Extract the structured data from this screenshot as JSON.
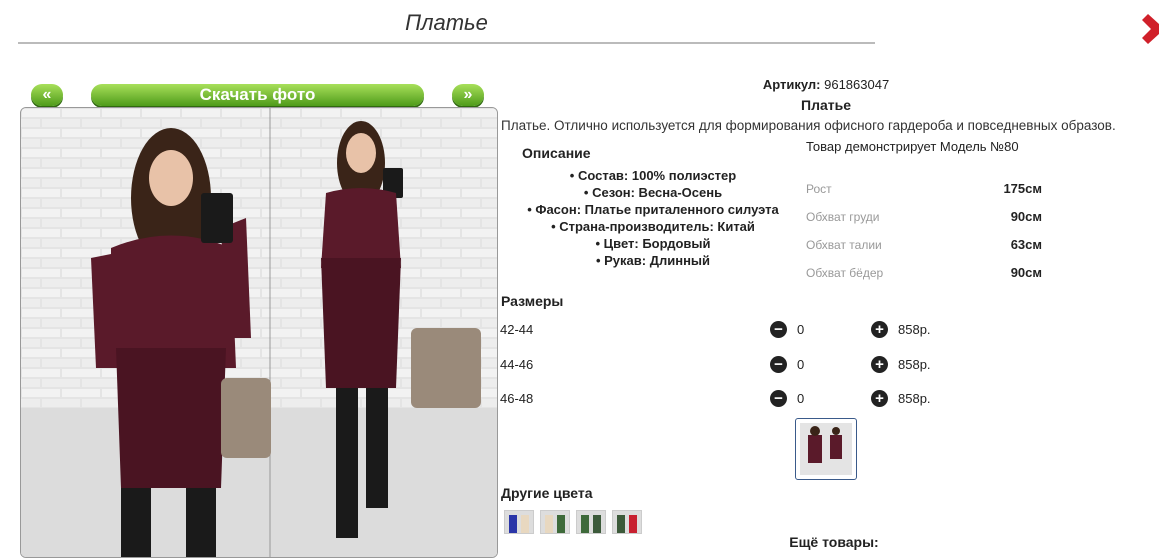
{
  "page": {
    "title": "Платье"
  },
  "photo_nav": {
    "prev_label": "«",
    "download_label": "Скачать фото",
    "next_label": "»"
  },
  "product": {
    "article_label": "Артикул:",
    "article_value": "961863047",
    "name": "Платье",
    "summary": "Платье. Отлично используется для формирования офисного гардероба и повседневных образов.",
    "description_heading": "Описание",
    "description_items": [
      "• Состав: 100% полиэстер",
      "• Сезон: Весна-Осень",
      "• Фасон: Платье приталенного силуэта",
      "• Страна-производитель: Китай",
      "• Цвет: Бордовый",
      "• Рукав: Длинный"
    ],
    "model_note": "Товар демонстрирует Модель №80",
    "measurements": [
      {
        "label": "Рост",
        "value": "175см"
      },
      {
        "label": "Обхват груди",
        "value": "90см"
      },
      {
        "label": "Обхват талии",
        "value": "63см"
      },
      {
        "label": "Обхват бёдер",
        "value": "90см"
      }
    ],
    "sizes_heading": "Размеры",
    "sizes": [
      {
        "size": "42-44",
        "qty": "0",
        "price": "858р."
      },
      {
        "size": "44-46",
        "qty": "0",
        "price": "858р."
      },
      {
        "size": "46-48",
        "qty": "0",
        "price": "858р."
      }
    ],
    "other_colors_heading": "Другие цвета",
    "other_colors": [
      "#2a35a8",
      "#e8d8c0",
      "#3e6a3a",
      "#3c5a3a",
      "#c82030"
    ],
    "more_products_heading": "Ещё товары:"
  },
  "colors": {
    "dress": "#5a1a2a",
    "accent_green": "#4f9b1a",
    "close_red": "#d0202a"
  }
}
